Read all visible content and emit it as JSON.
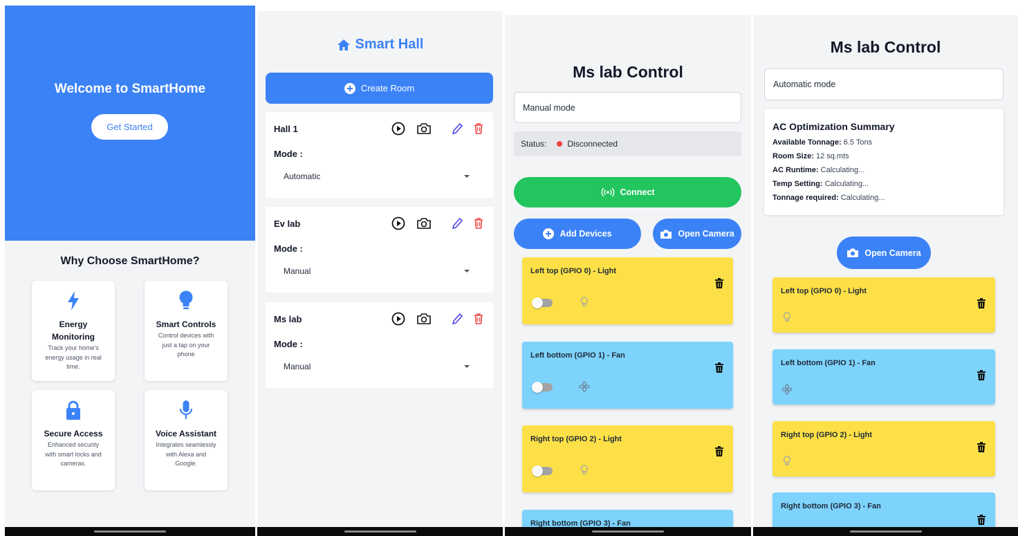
{
  "welcome": {
    "title": "Welcome to SmartHome",
    "get_started": "Get Started",
    "why_title": "Why Choose SmartHome?",
    "features": [
      {
        "icon": "lightning-icon",
        "title_lines": [
          "Energy",
          "Monitoring"
        ],
        "desc_lines": [
          "Track your home's",
          "energy usage in real",
          "time."
        ]
      },
      {
        "icon": "lightbulb-icon",
        "title_lines": [
          "Smart Controls"
        ],
        "desc_lines": [
          "Control devices with",
          "just a tap on your",
          "phone"
        ]
      },
      {
        "icon": "lock-icon",
        "title_lines": [
          "Secure Access"
        ],
        "desc_lines": [
          "Enhanced security",
          "with smart locks and",
          "cameras."
        ]
      },
      {
        "icon": "microphone-icon",
        "title_lines": [
          "Voice Assistant"
        ],
        "desc_lines": [
          "Integrates seamlessly",
          "with Alexa and",
          "Google."
        ]
      }
    ]
  },
  "hall": {
    "title": "Smart Hall",
    "title_icon": "home-icon",
    "create_room": "Create Room",
    "mode_label": "Mode :",
    "rooms": [
      {
        "name": "Hall 1",
        "mode": "Automatic"
      },
      {
        "name": "Ev lab",
        "mode": "Manual"
      },
      {
        "name": "Ms lab",
        "mode": "Manual"
      }
    ]
  },
  "control_manual": {
    "title": "Ms lab Control",
    "mode": "Manual mode",
    "status_label": "Status:",
    "status_value": "Disconnected",
    "connect": "Connect",
    "add_devices": "Add Devices",
    "open_camera": "Open Camera",
    "devices": [
      {
        "name": "Left top (GPIO 0) - Light",
        "type": "light",
        "on": false
      },
      {
        "name": "Left bottom  (GPIO 1) - Fan",
        "type": "fan",
        "on": false
      },
      {
        "name": "Right top (GPIO 2) - Light",
        "type": "light",
        "on": false
      },
      {
        "name": "Right bottom (GPIO 3) - Fan",
        "type": "fan",
        "on": false
      }
    ]
  },
  "control_auto": {
    "title": "Ms lab Control",
    "mode": "Automatic mode",
    "summary": {
      "title": "AC Optimization Summary",
      "rows": [
        {
          "label": "Available Tonnage:",
          "value": "6.5 Tons"
        },
        {
          "label": "Room Size:",
          "value": "12 sq.mts"
        },
        {
          "label": "AC Runtime:",
          "value": "Calculating..."
        },
        {
          "label": "Temp Setting:",
          "value": "Calculating..."
        },
        {
          "label": "Tonnage required:",
          "value": "Calculating..."
        }
      ]
    },
    "open_camera": "Open Camera",
    "devices": [
      {
        "name": "Left top (GPIO 0) - Light",
        "type": "light"
      },
      {
        "name": "Left bottom  (GPIO 1) - Fan",
        "type": "fan"
      },
      {
        "name": "Right top (GPIO 2) - Light",
        "type": "light"
      },
      {
        "name": "Right bottom (GPIO 3) - Fan",
        "type": "fan"
      }
    ]
  },
  "colors": {
    "primary": "#3b82f6",
    "connect": "#22c55e",
    "light_card": "#fde047",
    "fan_card": "#7dd3fc",
    "delete": "#ef4444",
    "status_disconnected": "#ef4444"
  }
}
